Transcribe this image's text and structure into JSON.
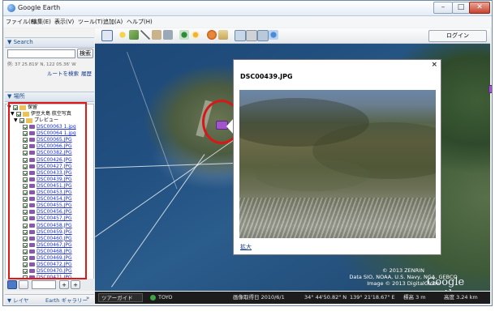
{
  "window": {
    "title": "Google Earth",
    "minimize_glyph": "–",
    "maximize_glyph": "□",
    "close_glyph": "✕"
  },
  "menu": [
    "ファイル(F)",
    "編集(E)",
    "表示(V)",
    "ツール(T)",
    "追加(A)",
    "ヘルプ(H)"
  ],
  "toolbar": {
    "login_label": "ログイン",
    "icons": [
      "sidebar-toggle-icon",
      "placemark-icon",
      "polygon-icon",
      "path-icon",
      "image-overlay-icon",
      "record-tour-icon",
      "historical-imagery-icon",
      "sunlight-icon",
      "planets-icon",
      "ruler-icon",
      "email-icon",
      "print-icon",
      "save-image-icon",
      "view-in-maps-icon"
    ]
  },
  "search": {
    "section_label": "▼ Search",
    "query_value": "",
    "search_button": "検索",
    "coords_text": "例: 37 25.819' N, 122 05.36' W",
    "route_link": "ルートを検索",
    "history_link": "履歴"
  },
  "places": {
    "section_label": "▼ 場所",
    "root_label": "保留",
    "folder_label": "伊豆大島 航空写真",
    "subfolder_label": "プレビュー",
    "files": [
      "DSC00063 1.jpg",
      "DSC00064 1.jpg",
      "DSC00065.JPG",
      "DSC00066.JPG",
      "DSC00382.JPG",
      "DSC00426.JPG",
      "DSC00427.JPG",
      "DSC00433.JPG",
      "DSC00439.JPG",
      "DSC00451.JPG",
      "DSC00453.JPG",
      "DSC00454.JPG",
      "DSC00455.JPG",
      "DSC00456.JPG",
      "DSC00457.JPG",
      "DSC00458.JPG",
      "DSC00459.JPG",
      "DSC00460.JPG",
      "DSC00467.JPG",
      "DSC00468.JPG",
      "DSC00469.JPG",
      "DSC00472.JPG",
      "DSC00470.JPG",
      "DSC00471.JPG"
    ]
  },
  "sidebar_bottom": {
    "plus": "+",
    "minus": "+"
  },
  "bottom_tabs": {
    "layers": "▼ レイヤ",
    "gallery": "Earth ギャラリー",
    "gallery_arrow": "»"
  },
  "popup": {
    "title": "DSC00439.JPG",
    "close_glyph": "×",
    "expand_link": "拡大"
  },
  "map": {
    "credit_line1": "© 2013 ZENRIN",
    "credit_line2": "Data SIO, NOAA, U.S. Navy, NGA, GEBCO",
    "credit_line3": "Image © 2013 DigitalGlobe",
    "logo_text": "Google earth",
    "zoom_plus": "+",
    "zoom_minus": "–"
  },
  "statusbar": {
    "tour_guide": "ツアーガイド",
    "imagery_date": "画像取得日 2010/6/1",
    "lat": "34° 44'50.82\" N",
    "lon": "139° 21'18.67\" E",
    "elevation": "標高 3 m",
    "eye_alt": "高度 3.24 km"
  },
  "colors": {
    "annotation_red": "#e01818",
    "link_blue": "#1a2fd0",
    "placemark_purple": "#a055c8"
  }
}
